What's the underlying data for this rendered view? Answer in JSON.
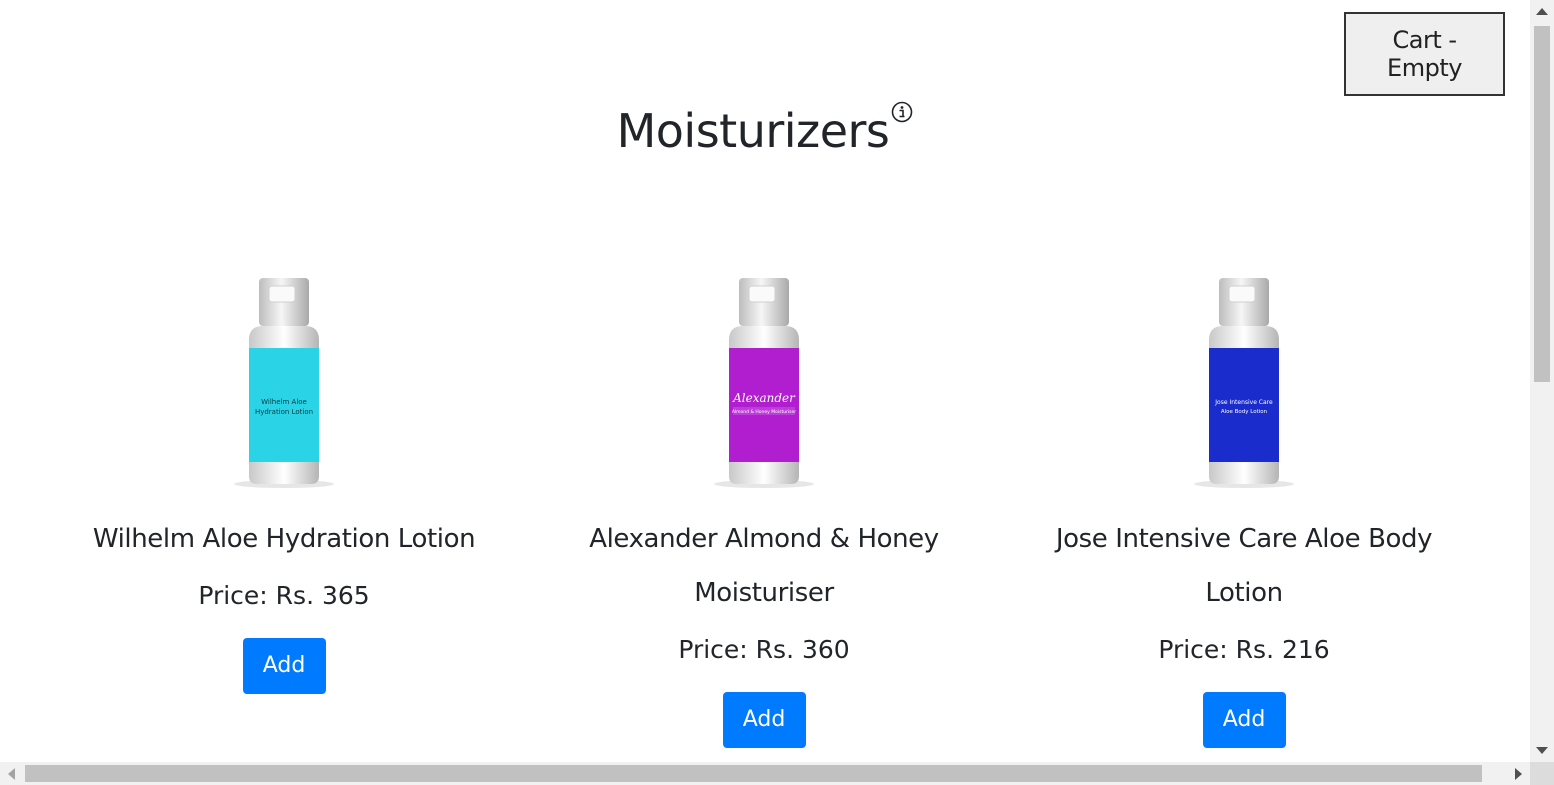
{
  "header": {
    "cart_label": "Cart - Empty",
    "title": "Moisturizers"
  },
  "products": [
    {
      "name": "Wilhelm Aloe Hydration Lotion",
      "price": "Price: Rs. 365",
      "add_label": "Add",
      "label_color": "#2ad4e6",
      "bottle_text_line1": "Wilhelm Aloe",
      "bottle_text_line2": "Hydration Lotion",
      "bottle_text_color": "#0b3b40"
    },
    {
      "name": "Alexander Almond & Honey Moisturiser",
      "price": "Price: Rs. 360",
      "add_label": "Add",
      "label_color": "#b01ecf",
      "bottle_text_line1": "Alexander",
      "bottle_text_line2": "Almond & Honey Moisturiser",
      "bottle_text_color": "#ffffff"
    },
    {
      "name": "Jose Intensive Care Aloe Body Lotion",
      "price": "Price: Rs. 216",
      "add_label": "Add",
      "label_color": "#1a2ccc",
      "bottle_text_line1": "Jose Intensive Care",
      "bottle_text_line2": "Aloe Body Lotion",
      "bottle_text_color": "#ffffff"
    }
  ],
  "colors": {
    "accent": "#007bff",
    "text": "#212529"
  },
  "icons": {
    "info": "info-icon"
  }
}
